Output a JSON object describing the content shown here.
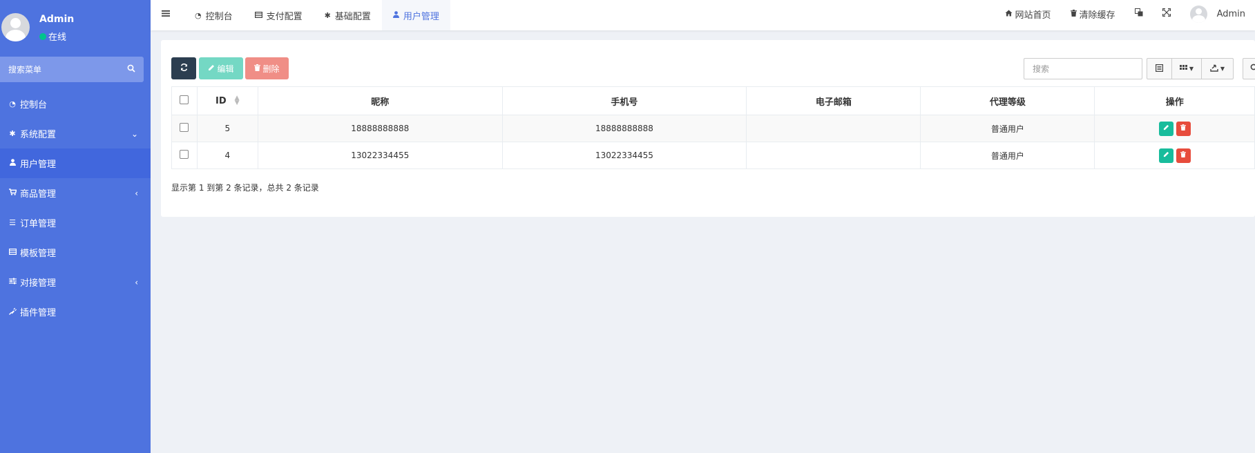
{
  "sidebar": {
    "user": {
      "name": "Admin",
      "status": "在线"
    },
    "search_placeholder": "搜索菜单",
    "items": [
      {
        "label": "控制台",
        "icon": "dashboard-icon",
        "arrow": ""
      },
      {
        "label": "系统配置",
        "icon": "gear-icon",
        "arrow": "⌄"
      },
      {
        "label": "用户管理",
        "icon": "user-icon",
        "arrow": "",
        "active": true
      },
      {
        "label": "商品管理",
        "icon": "cart-icon",
        "arrow": "‹"
      },
      {
        "label": "订单管理",
        "icon": "list-icon",
        "arrow": ""
      },
      {
        "label": "模板管理",
        "icon": "template-icon",
        "arrow": ""
      },
      {
        "label": "对接管理",
        "icon": "sliders-icon",
        "arrow": "‹"
      },
      {
        "label": "插件管理",
        "icon": "plug-icon",
        "arrow": ""
      }
    ]
  },
  "topbar": {
    "tabs": [
      {
        "label": "控制台",
        "icon": "dashboard-icon"
      },
      {
        "label": "支付配置",
        "icon": "list-icon"
      },
      {
        "label": "基础配置",
        "icon": "gear-icon"
      },
      {
        "label": "用户管理",
        "icon": "user-icon",
        "active": true
      }
    ],
    "home_label": "网站首页",
    "clear_cache_label": "清除缓存",
    "user_name": "Admin"
  },
  "toolbar": {
    "edit_label": "编辑",
    "delete_label": "删除",
    "search_placeholder": "搜索"
  },
  "table": {
    "columns": [
      "ID",
      "昵称",
      "手机号",
      "电子邮箱",
      "代理等级",
      "操作"
    ],
    "rows": [
      {
        "id": "5",
        "nickname": "18888888888",
        "phone": "18888888888",
        "email": "",
        "level": "普通用户"
      },
      {
        "id": "4",
        "nickname": "13022334455",
        "phone": "13022334455",
        "email": "",
        "level": "普通用户"
      }
    ]
  },
  "summary": "显示第 1 到第 2 条记录，总共 2 条记录",
  "colors": {
    "sidebar_bg": "#4e73df",
    "sidebar_active": "#4167dd",
    "accent": "#4e73df",
    "btn_dark": "#2c3e50",
    "btn_edit": "#18bc9c",
    "btn_delete": "#e74c3c",
    "online": "#00c48c"
  }
}
